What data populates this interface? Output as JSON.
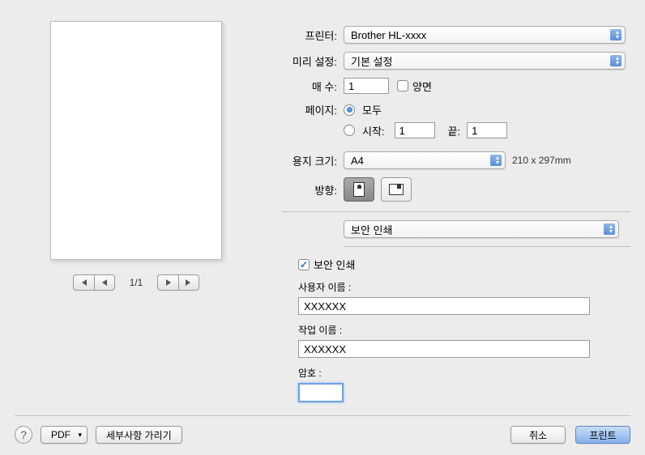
{
  "labels": {
    "printer": "프린터:",
    "preset": "미리 설정:",
    "copies": "매 수:",
    "twosided": "양면",
    "pages": "페이지:",
    "all": "모두",
    "from": "시작:",
    "to": "끝:",
    "papersize": "용지 크기:",
    "orientation": "방향:"
  },
  "printer": "Brother HL-xxxx",
  "preset": "기본 설정",
  "copies": "1",
  "pages": {
    "from": "1",
    "to": "1"
  },
  "paper": {
    "size": "A4",
    "dims": "210 x 297mm"
  },
  "dropdown": "보안 인쇄",
  "secure": {
    "label": "보안 인쇄",
    "user_label": "사용자 이름 :",
    "user": "XXXXXX",
    "job_label": "작업 이름 :",
    "job": "XXXXXX",
    "pw_label": "암호 :",
    "pw": ""
  },
  "pager": "1/1",
  "footer": {
    "pdf": "PDF",
    "details": "세부사항 가리기",
    "cancel": "취소",
    "print": "프린트"
  }
}
